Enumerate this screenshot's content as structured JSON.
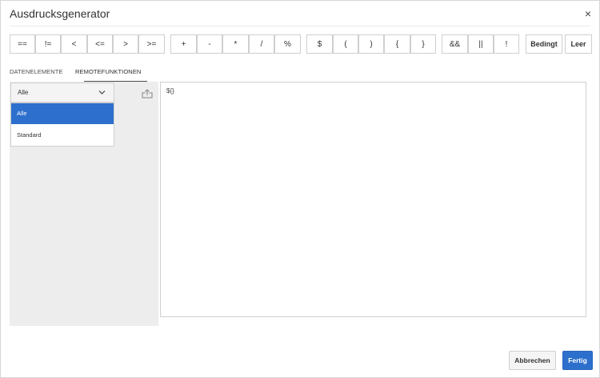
{
  "dialog": {
    "title": "Ausdrucksgenerator",
    "close_label": "×"
  },
  "toolbar": {
    "operators": [
      "==",
      "!=",
      "<",
      "<=",
      ">",
      ">=",
      "+",
      "-",
      "*",
      "/",
      "%",
      "$",
      "(",
      ")",
      "{",
      "}",
      "&&",
      "||",
      "!",
      "Bedingt",
      "Leer"
    ]
  },
  "tabs": {
    "data_elements": "DATENELEMENTE",
    "remote_functions": "REMOTEFUNKTIONEN"
  },
  "filter": {
    "selected": "Alle",
    "options": [
      "Alle",
      "Standard"
    ]
  },
  "editor": {
    "value": "${}"
  },
  "footer": {
    "cancel_label": "Abbrechen",
    "done_label": "Fertig"
  },
  "colors": {
    "accent": "#2d6fcc",
    "panel_bg": "#ededed"
  },
  "icons": {
    "close": "close-icon",
    "chevron": "chevron-down-icon",
    "export": "export-icon"
  }
}
